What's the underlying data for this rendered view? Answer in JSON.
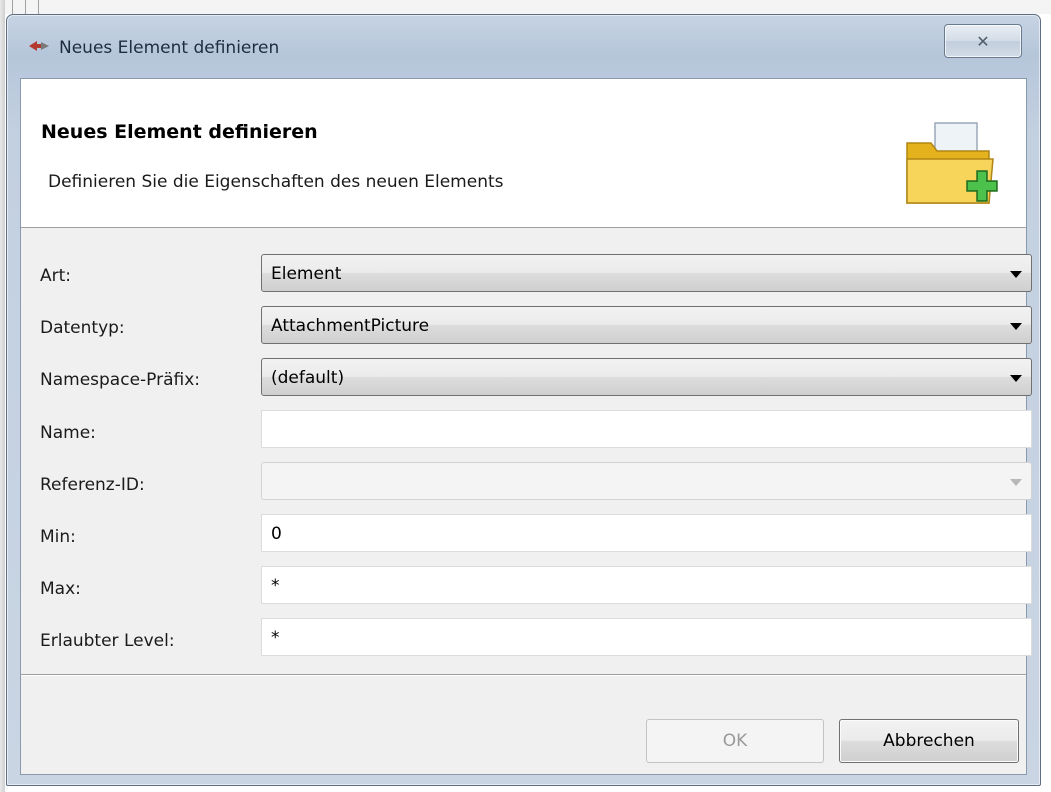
{
  "window": {
    "title": "Neues Element definieren",
    "close_glyph": "✕"
  },
  "header": {
    "title": "Neues Element definieren",
    "subtitle": "Definieren Sie die Eigenschaften des neuen Elements",
    "icon": "folder-add-icon"
  },
  "form": {
    "art": {
      "label": "Art:",
      "value": "Element"
    },
    "datentyp": {
      "label": "Datentyp:",
      "value": "AttachmentPicture"
    },
    "namespace": {
      "label": "Namespace-Präfix:",
      "value": "(default)"
    },
    "name": {
      "label": "Name:",
      "value": ""
    },
    "referenz": {
      "label": "Referenz-ID:",
      "value": ""
    },
    "min": {
      "label": "Min:",
      "value": "0"
    },
    "max": {
      "label": "Max:",
      "value": "*"
    },
    "level": {
      "label": "Erlaubter Level:",
      "value": "*"
    }
  },
  "buttons": {
    "ok": "OK",
    "cancel": "Abbrechen"
  },
  "colors": {
    "accent": "#5d6e84",
    "folder": "#f2c230",
    "plus": "#3aa63a"
  }
}
